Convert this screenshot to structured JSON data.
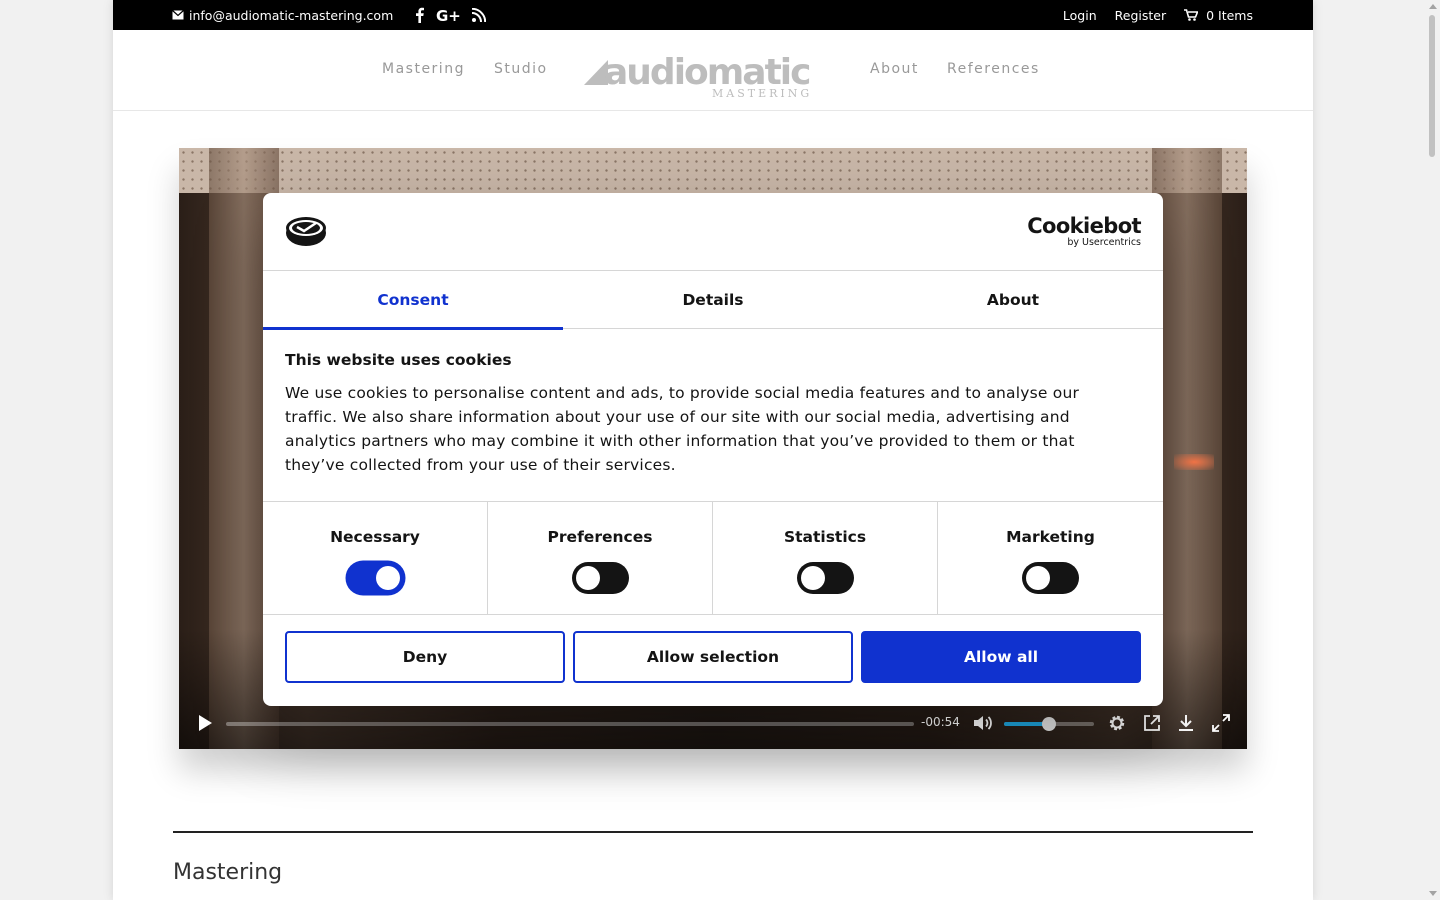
{
  "topbar": {
    "email": "info@audiomatic-mastering.com",
    "social_icons": [
      "facebook-icon",
      "google-plus-icon",
      "rss-icon"
    ],
    "login": "Login",
    "register": "Register",
    "cart": "0 Items"
  },
  "nav": {
    "items": [
      "Mastering",
      "Studio",
      "About",
      "References"
    ],
    "logo_text": "audiomatic",
    "logo_sub": "MASTERING"
  },
  "video": {
    "time_remaining": "-00:54",
    "volume_level": 0.5,
    "progress": 0
  },
  "cookie": {
    "brand": "Cookiebot",
    "brand_sub": "by Usercentrics",
    "tabs": [
      "Consent",
      "Details",
      "About"
    ],
    "active_tab": "Consent",
    "heading": "This website uses cookies",
    "text": "We use cookies to personalise content and ads, to provide social media features and to analyse our traffic. We also share information about your use of our site with our social media, advertising and analytics partners who may combine it with other information that you’ve provided to them or that they’ve collected from your use of their services.",
    "categories": [
      {
        "label": "Necessary",
        "on": true
      },
      {
        "label": "Preferences",
        "on": false
      },
      {
        "label": "Statistics",
        "on": false
      },
      {
        "label": "Marketing",
        "on": false
      }
    ],
    "buttons": {
      "deny": "Deny",
      "selection": "Allow selection",
      "all": "Allow all"
    }
  },
  "main": {
    "section_title": "Mastering"
  },
  "colors": {
    "accent": "#1032cf",
    "volume": "#1ea7e1"
  }
}
